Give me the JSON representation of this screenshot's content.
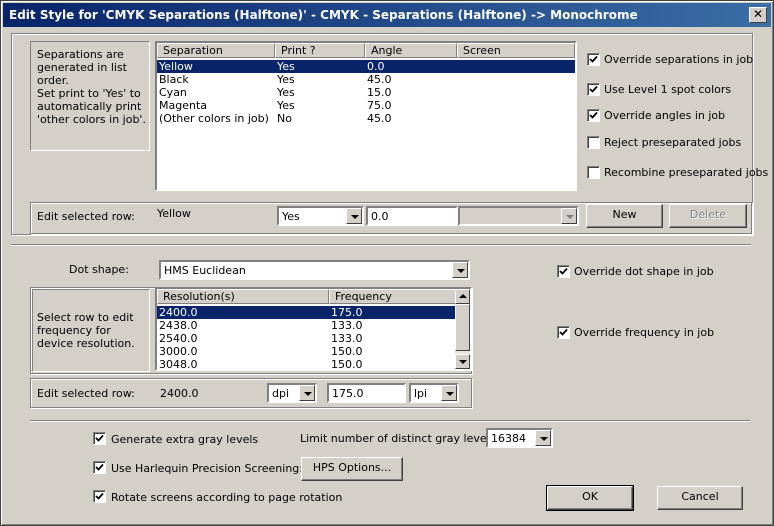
{
  "window": {
    "title": "Edit Style for 'CMYK Separations (Halftone)' - CMYK - Separations (Halftone) -> Monochrome",
    "close_glyph": "✕"
  },
  "separations": {
    "info_lines": [
      "Separations are",
      "generated in list",
      "order.",
      "Set print to 'Yes' to",
      "automatically print",
      "'other colors in job'."
    ],
    "columns": [
      "Separation",
      "Print ?",
      "Angle",
      "Screen"
    ],
    "rows": [
      {
        "separation": "Yellow",
        "print": "Yes",
        "angle": "0.0",
        "screen": ""
      },
      {
        "separation": "Black",
        "print": "Yes",
        "angle": "45.0",
        "screen": ""
      },
      {
        "separation": "Cyan",
        "print": "Yes",
        "angle": "15.0",
        "screen": ""
      },
      {
        "separation": "Magenta",
        "print": "Yes",
        "angle": "75.0",
        "screen": ""
      },
      {
        "separation": "(Other colors in job)",
        "print": "No",
        "angle": "45.0",
        "screen": ""
      }
    ],
    "options": [
      {
        "label": "Override separations in job",
        "checked": true
      },
      {
        "label": "Use Level 1 spot colors",
        "checked": true
      },
      {
        "label": "Override angles in job",
        "checked": true
      },
      {
        "label": "Reject preseparated jobs",
        "checked": false
      },
      {
        "label": "Recombine preseparated jobs",
        "checked": false
      }
    ],
    "edit_row": {
      "label": "Edit selected row:",
      "value": "Yellow",
      "print_select": "Yes",
      "angle_input": "0.0",
      "screen_select": "",
      "new_button": "New",
      "delete_button": "Delete"
    }
  },
  "dots": {
    "dot_shape_label": "Dot shape:",
    "dot_shape_value": "HMS Euclidean",
    "override_dot_shape": {
      "label": "Override dot shape in job",
      "checked": true
    },
    "info_lines": [
      "Select row to edit",
      "frequency for",
      "device resolution."
    ],
    "columns": [
      "Resolution(s)",
      "Frequency"
    ],
    "rows": [
      {
        "resolution": "2400.0",
        "frequency": "175.0"
      },
      {
        "resolution": "2438.0",
        "frequency": "133.0"
      },
      {
        "resolution": "2540.0",
        "frequency": "133.0"
      },
      {
        "resolution": "3000.0",
        "frequency": "150.0"
      },
      {
        "resolution": "3048.0",
        "frequency": "150.0"
      }
    ],
    "override_frequency": {
      "label": "Override frequency in job",
      "checked": true
    },
    "edit_row": {
      "label": "Edit selected row:",
      "value": "2400.0",
      "res_unit": "dpi",
      "freq_input": "175.0",
      "freq_unit": "lpi"
    }
  },
  "bottom": {
    "generate_gray": {
      "label": "Generate extra gray levels",
      "checked": true
    },
    "limit_label": "Limit number of distinct gray levels to:",
    "limit_value": "16384",
    "harlequin": {
      "label": "Use Harlequin Precision Screening:",
      "checked": true
    },
    "hps_button": "HPS Options...",
    "rotate": {
      "label": "Rotate screens according to page rotation",
      "checked": true
    },
    "ok_button": "OK",
    "cancel_button": "Cancel"
  }
}
